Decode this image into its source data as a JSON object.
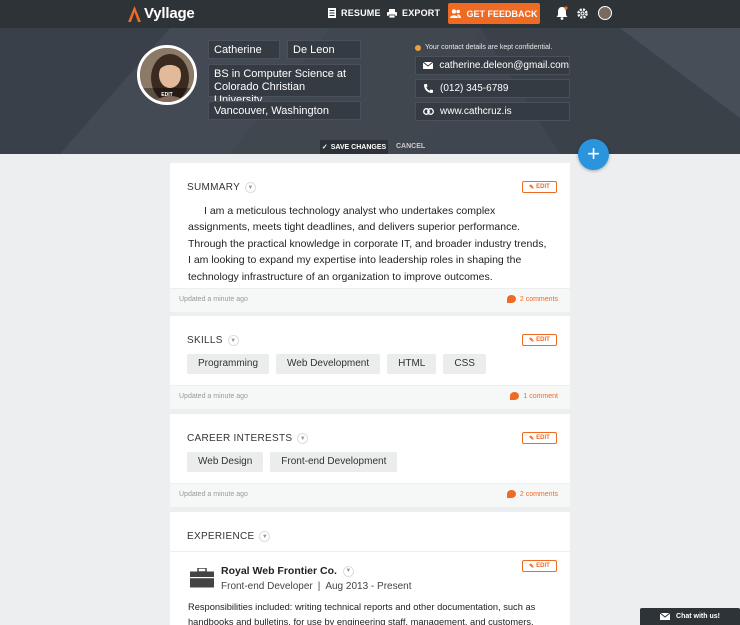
{
  "app": {
    "name": "Vyllage"
  },
  "nav": {
    "resume_label": "RESUME",
    "export_label": "EXPORT",
    "feedback_label": "GET FEEDBACK"
  },
  "colors": {
    "accent": "#ef6a23",
    "header_bg": "#3f4650",
    "nav_bg": "#2e3338",
    "fab": "#2a95dd"
  },
  "profile": {
    "first_name": "Catherine",
    "last_name": "De Leon",
    "tagline": "BS in Computer Science at Colorado Christian University",
    "location": "Vancouver, Washington",
    "avatar_edit_label": "EDIT"
  },
  "contact": {
    "note": "Your contact details are kept confidential.",
    "email": "catherine.deleon@gmail.com",
    "phone": "(012) 345-6789",
    "website": "www.cathcruz.is"
  },
  "header_actions": {
    "save_label": "SAVE CHANGES",
    "cancel_label": "CANCEL"
  },
  "common": {
    "edit_label": "EDIT"
  },
  "summary": {
    "title": "SUMMARY",
    "text": "I am a meticulous technology analyst who undertakes complex assignments, meets tight deadlines, and delivers superior performance. Through the practical knowledge in corporate IT, and broader industry trends, I am looking to expand my expertise into leadership roles in shaping the technology infrastructure of an organization to improve outcomes.",
    "updated": "Updated a minute ago",
    "comments": "2 comments"
  },
  "skills": {
    "title": "SKILLS",
    "tags": [
      "Programming",
      "Web Development",
      "HTML",
      "CSS"
    ],
    "updated": "Updated a minute ago",
    "comments": "1 comment"
  },
  "career": {
    "title": "CAREER INTERESTS",
    "tags": [
      "Web Design",
      "Front-end Development"
    ],
    "updated": "Updated a minute ago",
    "comments": "2 comments"
  },
  "experience": {
    "title": "EXPERIENCE",
    "company": "Royal Web Frontier Co.",
    "role": "Front-end Developer",
    "separator": "|",
    "dates": "Aug 2013 - Present",
    "text": "Responsibilities included: writing technical reports and other documentation, such as handbooks and bulletins, for use by engineering staff, management, and customers, analyzing project requests and"
  },
  "chat": {
    "label": "Chat with us!"
  }
}
